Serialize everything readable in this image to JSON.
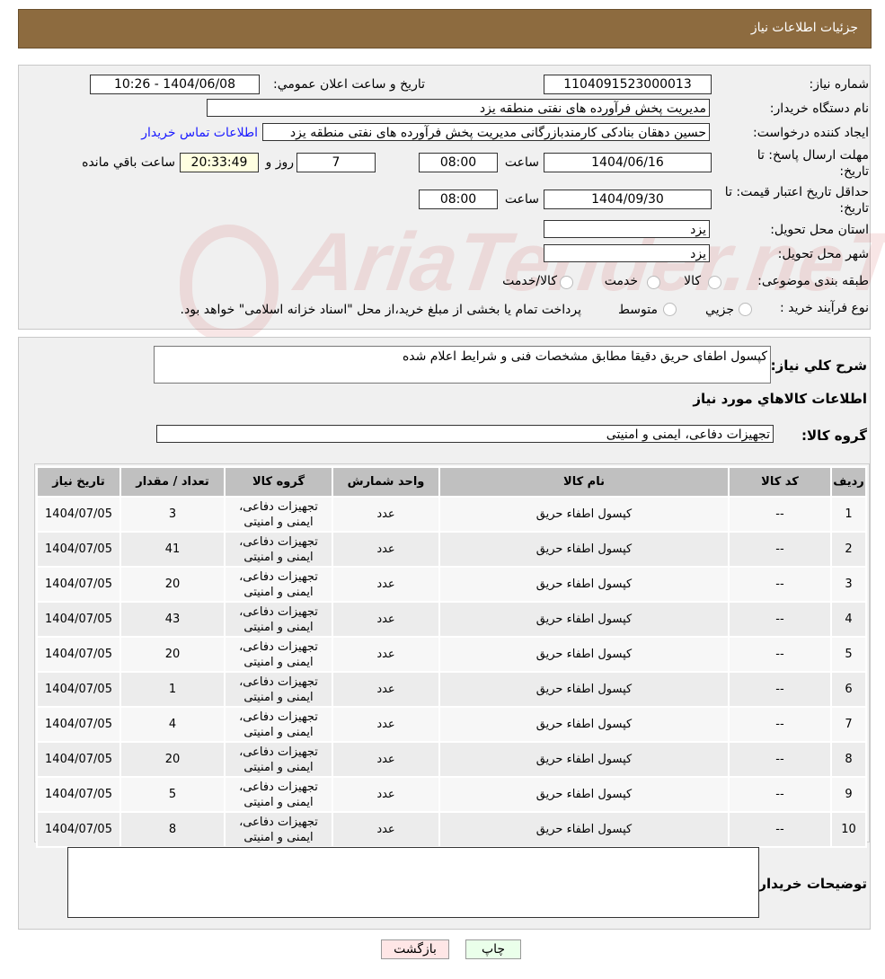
{
  "header": {
    "title": "جزئیات اطلاعات نیاز"
  },
  "form": {
    "need_number_label": "شماره نیاز:",
    "need_number": "1104091523000013",
    "announce_label": "تاریخ و ساعت اعلان عمومي:",
    "announce_value": "1404/06/08 - 10:26",
    "buyer_org_label": "نام دستگاه خریدار:",
    "buyer_org": "مدیریت پخش فرآورده های نفتی منطقه یزد",
    "creator_label": "ایجاد کننده درخواست:",
    "creator": "حسین دهقان بنادکی کارمندبازرگانی مدیریت پخش فرآورده های نفتی منطقه یزد",
    "contact_link": "اطلاعات تماس خریدار",
    "deadline_label": "مهلت ارسال پاسخ: تا تاریخ:",
    "deadline_date": "1404/06/16",
    "time_label": "ساعت",
    "deadline_time": "08:00",
    "days": "7",
    "days_label": "روز و",
    "remaining": "20:33:49",
    "remaining_label": "ساعت باقي مانده",
    "validity_label": "حداقل تاریخ اعتبار قیمت: تا تاریخ:",
    "validity_date": "1404/09/30",
    "validity_time": "08:00",
    "province_label": "استان محل تحویل:",
    "province": "یزد",
    "city_label": "شهر محل تحویل:",
    "city": "یزد",
    "category_label": "طبقه بندی موضوعی:",
    "category_options": [
      "کالا",
      "خدمت",
      "کالا/خدمت"
    ],
    "process_label": "نوع فرآیند خرید :",
    "process_options": [
      "جزيي",
      "متوسط"
    ],
    "process_note": "پرداخت تمام یا بخشی از مبلغ خرید،از محل \"اسناد خزانه اسلامی\" خواهد بود."
  },
  "watermark": "AriaTender.neT",
  "details": {
    "desc_label": "شرح کلي نیاز:",
    "desc": "کپسول اطفای حریق دقیقا مطابق مشخصات فنی و شرایط اعلام شده",
    "goods_title": "اطلاعات کالاهاي مورد نیاز",
    "group_label": "گروه کالا:",
    "group": "تجهیزات دفاعی، ایمنی و امنیتی"
  },
  "table": {
    "headers": [
      "ردیف",
      "کد کالا",
      "نام کالا",
      "واحد شمارش",
      "گروه کالا",
      "تعداد / مقدار",
      "تاریخ نیاز"
    ],
    "rows": [
      [
        "1",
        "--",
        "کپسول اطفاء حریق",
        "عدد",
        "تجهیزات دفاعی، ایمنی و امنیتی",
        "3",
        "1404/07/05"
      ],
      [
        "2",
        "--",
        "کپسول اطفاء حریق",
        "عدد",
        "تجهیزات دفاعی، ایمنی و امنیتی",
        "41",
        "1404/07/05"
      ],
      [
        "3",
        "--",
        "کپسول اطفاء حریق",
        "عدد",
        "تجهیزات دفاعی، ایمنی و امنیتی",
        "20",
        "1404/07/05"
      ],
      [
        "4",
        "--",
        "کپسول اطفاء حریق",
        "عدد",
        "تجهیزات دفاعی، ایمنی و امنیتی",
        "43",
        "1404/07/05"
      ],
      [
        "5",
        "--",
        "کپسول اطفاء حریق",
        "عدد",
        "تجهیزات دفاعی، ایمنی و امنیتی",
        "20",
        "1404/07/05"
      ],
      [
        "6",
        "--",
        "کپسول اطفاء حریق",
        "عدد",
        "تجهیزات دفاعی، ایمنی و امنیتی",
        "1",
        "1404/07/05"
      ],
      [
        "7",
        "--",
        "کپسول اطفاء حریق",
        "عدد",
        "تجهیزات دفاعی، ایمنی و امنیتی",
        "4",
        "1404/07/05"
      ],
      [
        "8",
        "--",
        "کپسول اطفاء حریق",
        "عدد",
        "تجهیزات دفاعی، ایمنی و امنیتی",
        "20",
        "1404/07/05"
      ],
      [
        "9",
        "--",
        "کپسول اطفاء حریق",
        "عدد",
        "تجهیزات دفاعی، ایمنی و امنیتی",
        "5",
        "1404/07/05"
      ],
      [
        "10",
        "--",
        "کپسول اطفاء حریق",
        "عدد",
        "تجهیزات دفاعی، ایمنی و امنیتی",
        "8",
        "1404/07/05"
      ]
    ]
  },
  "buyer_notes": {
    "label": "توضیحات خریدار:",
    "value": ""
  },
  "buttons": {
    "print": "چاپ",
    "back": "بازگشت"
  }
}
